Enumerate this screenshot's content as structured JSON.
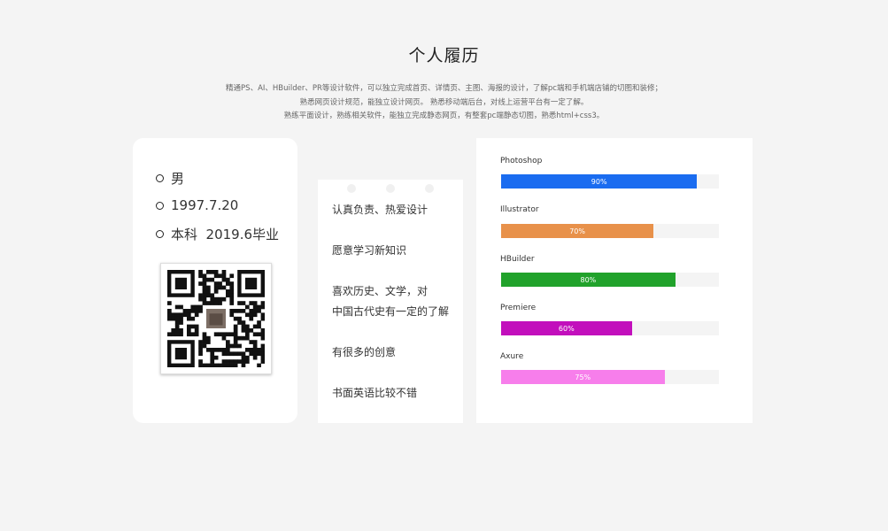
{
  "header": {
    "title": "个人履历",
    "intro": [
      "精通PS、AI、HBuilder、PR等设计软件，可以独立完成首页、详情页、主图、海报的设计，了解pc端和手机端店铺的切图和装修；",
      "熟悉网页设计规范，能独立设计网页。 熟悉移动端后台，对线上运营平台有一定了解。",
      "熟练平面设计，熟练相关软件，能独立完成静态网页，有整套pc端静态切图，熟悉html+css3。"
    ]
  },
  "profile": {
    "gender": "男",
    "birthday": "1997.7.20",
    "education": "本科  2019.6毕业",
    "qr_icon": "qr-code"
  },
  "traits": [
    "认真负责、热爱设计",
    "愿意学习新知识",
    "喜欢历史、文学，对",
    "中国古代史有一定的了解",
    "有很多的创意",
    "书面英语比较不错"
  ],
  "skills": [
    {
      "name": "Photoshop",
      "percent": 90,
      "label": "90%",
      "color": "#1a6cf0"
    },
    {
      "name": "Illustrator",
      "percent": 70,
      "label": "70%",
      "color": "#e8914a"
    },
    {
      "name": "HBuilder",
      "percent": 80,
      "label": "80%",
      "color": "#21a22b"
    },
    {
      "name": "Premiere",
      "percent": 60,
      "label": "60%",
      "color": "#c20fbc"
    },
    {
      "name": "Axure",
      "percent": 75,
      "label": "75%",
      "color": "#f77eeb"
    }
  ]
}
